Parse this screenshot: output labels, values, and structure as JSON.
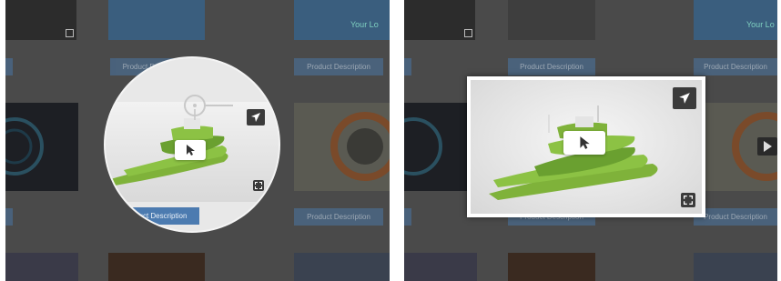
{
  "colors": {
    "overlay": "#4a4a4a",
    "button_blue": "#4a6a8c",
    "ship_green": "#7fb23a",
    "icon_dark": "#3b3b3b"
  },
  "left_panel": {
    "buttons": {
      "top_center": "Product Description",
      "top_right": "Product Description",
      "bottom_center": "Product Description",
      "bottom_right": "Product Description"
    },
    "thumb_text": "Your Lo",
    "icons": [
      "share-icon",
      "cursor-icon",
      "expand-icon"
    ]
  },
  "right_panel": {
    "buttons": {
      "top_center": "Product Description",
      "top_right": "Product Description",
      "bottom_center": "Product Description",
      "bottom_right": "Product Description"
    },
    "thumb_text": "Your Lo",
    "icons": [
      "share-icon",
      "cursor-icon",
      "expand-icon",
      "play-icon"
    ]
  }
}
